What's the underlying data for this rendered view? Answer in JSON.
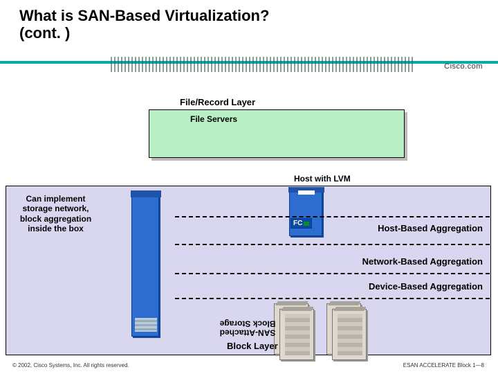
{
  "title_line1": "What is SAN-Based Virtualization?",
  "title_line2": "(cont. )",
  "brand": "Cisco.com",
  "labels": {
    "file_layer": "File/Record Layer",
    "file_servers": "File Servers",
    "host_lvm": "Host with LVM",
    "callout": "Can implement storage network, block aggregation inside the box",
    "agg_host": "Host-Based Aggregation",
    "agg_net": "Network-Based Aggregation",
    "agg_dev": "Device-Based Aggregation",
    "san_attached_l1": "SAN-Attached",
    "san_attached_l2": "Block Storage",
    "block_layer": "Block Layer",
    "fc": "FC"
  },
  "footer": {
    "copyright": "© 2002, Cisco Systems, Inc. All rights reserved.",
    "slidenum": "ESAN ACCELERATE Block 1—8"
  }
}
